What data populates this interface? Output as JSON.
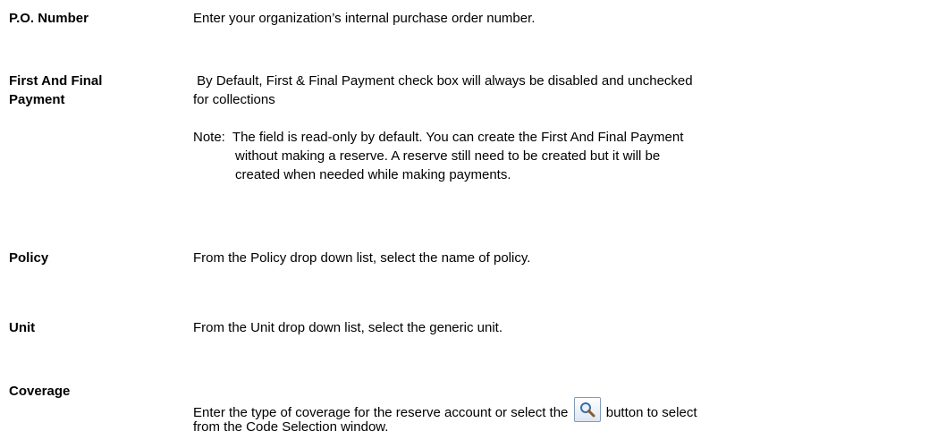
{
  "entries": [
    {
      "term": "P.O. Number",
      "description": "Enter your organization’s internal purchase order number."
    },
    {
      "term": "First And Final Payment",
      "description_line1": " By Default, First & Final Payment check box will always be disabled and unchecked",
      "description_line2": "for collections",
      "note": {
        "line1": "Note:  The field is read-only by default. You can create the First And Final Payment",
        "line2": "without making a reserve. A reserve still need to be created but it will be",
        "line3": "created when needed while making payments."
      }
    },
    {
      "term": "Policy",
      "description": "From the Policy drop down list, select the name of policy."
    },
    {
      "term": "Unit",
      "description": "From the Unit drop down list, select the generic unit."
    },
    {
      "term": "Coverage",
      "description_before_icon": "Enter the type of coverage for the reserve account or select the",
      "description_after_icon": "button to select",
      "description_line2": "from the Code Selection window.",
      "icon": "search-icon"
    }
  ]
}
